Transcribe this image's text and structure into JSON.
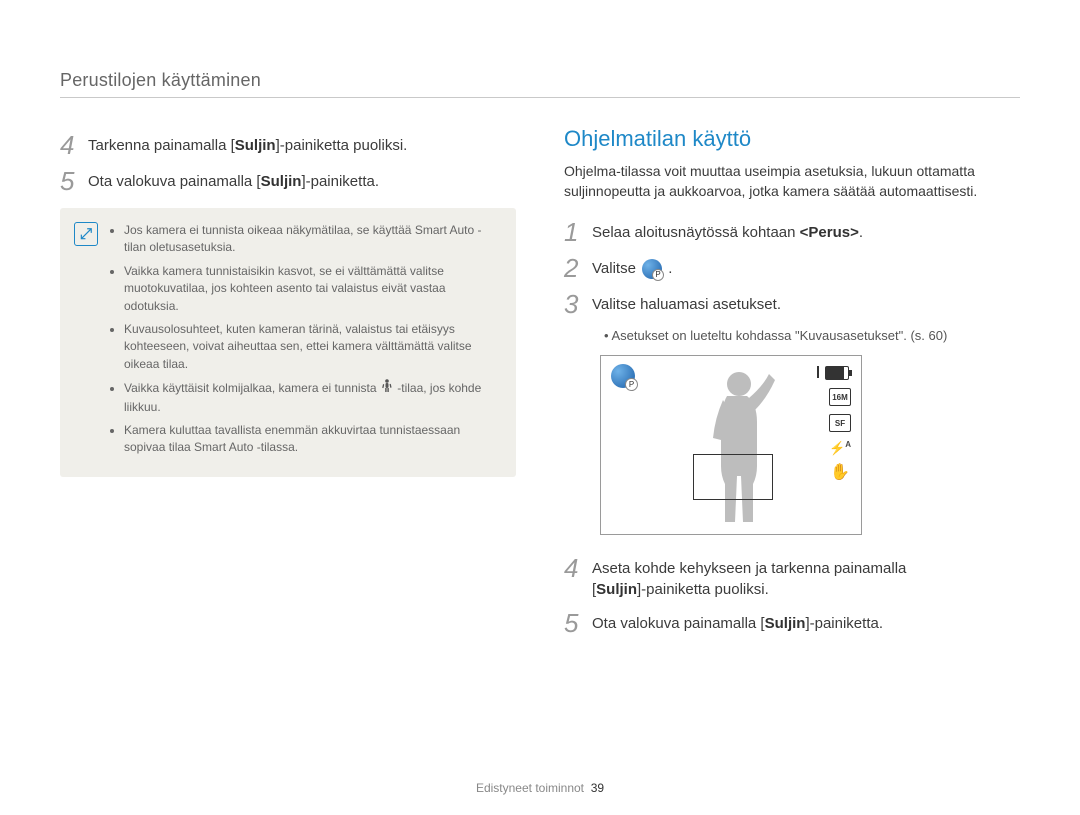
{
  "header": {
    "title": "Perustilojen käyttäminen"
  },
  "left": {
    "step4_num": "4",
    "step4_pre": "Tarkenna painamalla [",
    "step4_bold": "Suljin",
    "step4_post": "]-painiketta puoliksi.",
    "step5_num": "5",
    "step5_pre": "Ota valokuva painamalla [",
    "step5_bold": "Suljin",
    "step5_post": "]-painiketta.",
    "notes": {
      "b1": "Jos kamera ei tunnista oikeaa näkymätilaa, se käyttää Smart Auto -tilan oletusasetuksia.",
      "b2": "Vaikka kamera tunnistaisikin kasvot, se ei välttämättä valitse muotokuvatilaa, jos kohteen asento tai valaistus eivät vastaa odotuksia.",
      "b3": "Kuvausolosuhteet, kuten kameran tärinä, valaistus tai etäisyys kohteeseen, voivat aiheuttaa sen, ettei kamera välttämättä valitse oikeaa tilaa.",
      "b4_pre": "Vaikka käyttäisit kolmijalkaa, kamera ei tunnista ",
      "b4_post": " -tilaa, jos kohde liikkuu.",
      "b5": "Kamera kuluttaa tavallista enemmän akkuvirtaa tunnistaessaan sopivaa tilaa Smart Auto -tilassa."
    }
  },
  "right": {
    "title": "Ohjelmatilan käyttö",
    "intro": "Ohjelma-tilassa voit muuttaa useimpia asetuksia, lukuun ottamatta suljinnopeutta ja aukkoarvoa, jotka kamera säätää automaattisesti.",
    "step1_num": "1",
    "step1_pre": "Selaa aloitusnäytössä kohtaan ",
    "step1_bold": "<Perus>",
    "step1_post": ".",
    "step2_num": "2",
    "step2_pre": "Valitse ",
    "step2_post": ".",
    "step3_num": "3",
    "step3_text": "Valitse haluamasi asetukset.",
    "step3_sub": "Asetukset on lueteltu kohdassa \"Kuvausasetukset\". (s. 60)",
    "cam": {
      "size_label": "16M",
      "quality_label": "SF",
      "flash_label": "A",
      "flash_glyph": "⚡"
    },
    "step4_num": "4",
    "step4a_pre": "Aseta kohde kehykseen ja tarkenna painamalla",
    "step4b_pre": "[",
    "step4b_bold": "Suljin",
    "step4b_post": "]-painiketta puoliksi.",
    "step5_num": "5",
    "step5_pre": "Ota valokuva painamalla [",
    "step5_bold": "Suljin",
    "step5_post": "]-painiketta."
  },
  "footer": {
    "section": "Edistyneet toiminnot",
    "page": "39"
  }
}
